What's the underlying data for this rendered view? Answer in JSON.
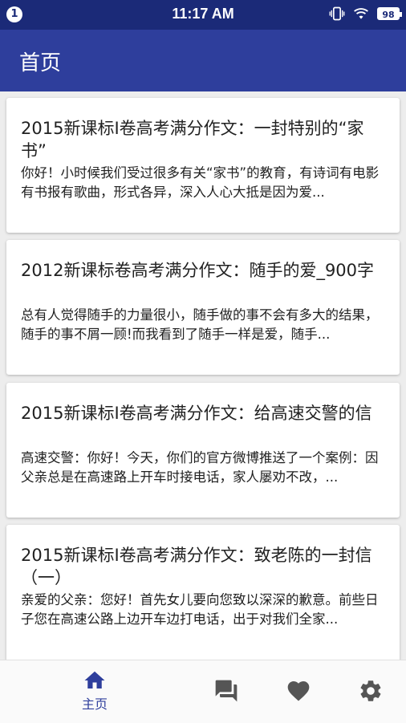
{
  "status_bar": {
    "notification_count": "1",
    "time": "11:17 AM",
    "battery": "98"
  },
  "app_bar": {
    "title": "首页"
  },
  "articles": [
    {
      "title": "2015新课标I卷高考满分作文：一封特别的“家书”",
      "summary": "你好！小时候我们受过很多有关“家书”的教育，有诗词有电影有书报有歌曲，形式各异，深入人心大抵是因为爱..."
    },
    {
      "title": "2012新课标卷高考满分作文：随手的爱_900字",
      "summary": "总有人觉得随手的力量很小，随手做的事不会有多大的结果，随手的事不屑一顾!而我看到了随手一样是爱，随手..."
    },
    {
      "title": "2015新课标I卷高考满分作文：给高速交警的信",
      "summary": "高速交警：你好！今天，你们的官方微博推送了一个案例：因父亲总是在高速路上开车时接电话，家人屡劝不改，..."
    },
    {
      "title": "2015新课标I卷高考满分作文：致老陈的一封信（一）",
      "summary": "亲爱的父亲：您好！首先女儿要向您致以深深的歉意。前些日子您在高速公路上边开车边打电话，出于对我们全家..."
    }
  ],
  "bottom_nav": {
    "home_label": "主页",
    "items": [
      {
        "icon": "home-icon",
        "active": true
      },
      {
        "icon": "chat-icon",
        "active": false
      },
      {
        "icon": "heart-icon",
        "active": false
      },
      {
        "icon": "settings-gear-icon",
        "active": false
      }
    ],
    "active_color": "#2e3e9c",
    "inactive_color": "#555555"
  }
}
